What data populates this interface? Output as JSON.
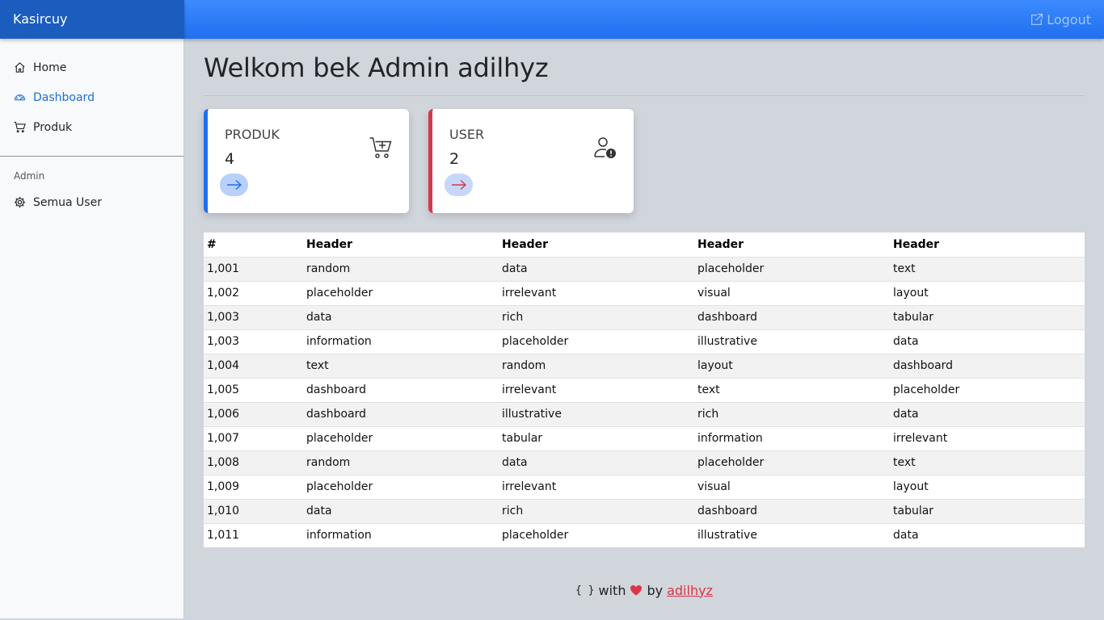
{
  "app": {
    "brand": "Kasircuy",
    "logout_label": "Logout"
  },
  "sidebar": {
    "items": [
      {
        "label": "Home",
        "icon": "house-icon",
        "active": false
      },
      {
        "label": "Dashboard",
        "icon": "speedometer-icon",
        "active": true
      },
      {
        "label": "Produk",
        "icon": "cart-icon",
        "active": false
      }
    ],
    "section_label": "Admin",
    "admin_items": [
      {
        "label": "Semua User",
        "icon": "gear-icon"
      }
    ]
  },
  "main": {
    "title": "Welkom bek Admin adilhyz",
    "cards": [
      {
        "label": "PRODUK",
        "value": "4",
        "accent": "#1d6ff2",
        "icon": "cart-plus-icon"
      },
      {
        "label": "USER",
        "value": "2",
        "accent": "#dc3545",
        "icon": "person-exclamation-icon"
      }
    ]
  },
  "table": {
    "headers": [
      "#",
      "Header",
      "Header",
      "Header",
      "Header"
    ],
    "rows": [
      [
        "1,001",
        "random",
        "data",
        "placeholder",
        "text"
      ],
      [
        "1,002",
        "placeholder",
        "irrelevant",
        "visual",
        "layout"
      ],
      [
        "1,003",
        "data",
        "rich",
        "dashboard",
        "tabular"
      ],
      [
        "1,003",
        "information",
        "placeholder",
        "illustrative",
        "data"
      ],
      [
        "1,004",
        "text",
        "random",
        "layout",
        "dashboard"
      ],
      [
        "1,005",
        "dashboard",
        "irrelevant",
        "text",
        "placeholder"
      ],
      [
        "1,006",
        "dashboard",
        "illustrative",
        "rich",
        "data"
      ],
      [
        "1,007",
        "placeholder",
        "tabular",
        "information",
        "irrelevant"
      ],
      [
        "1,008",
        "random",
        "data",
        "placeholder",
        "text"
      ],
      [
        "1,009",
        "placeholder",
        "irrelevant",
        "visual",
        "layout"
      ],
      [
        "1,010",
        "data",
        "rich",
        "dashboard",
        "tabular"
      ],
      [
        "1,011",
        "information",
        "placeholder",
        "illustrative",
        "data"
      ]
    ]
  },
  "footer": {
    "braces": "{ }",
    "with": "with",
    "by": "by",
    "author": "adilhyz",
    "heart_color": "#dc3545"
  }
}
